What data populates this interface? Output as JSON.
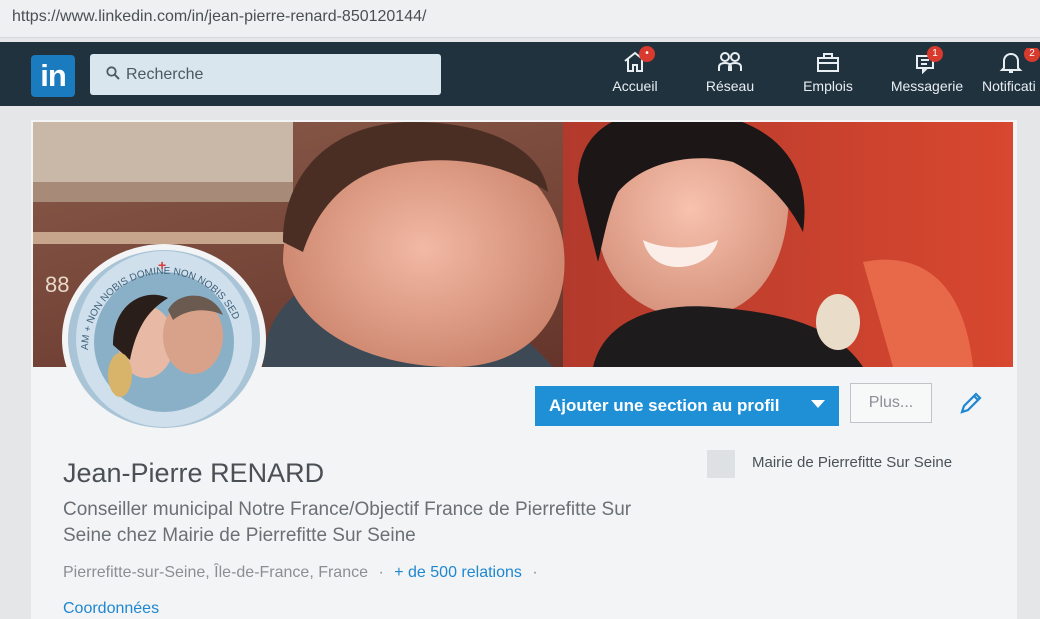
{
  "browser": {
    "url": "https://www.linkedin.com/in/jean-pierre-renard-850120144/"
  },
  "navbar": {
    "logo_text": "in",
    "search_placeholder": "Recherche",
    "items": [
      {
        "label": "Accueil",
        "icon": "home-icon",
        "badge": "•"
      },
      {
        "label": "Réseau",
        "icon": "network-icon"
      },
      {
        "label": "Emplois",
        "icon": "briefcase-icon"
      },
      {
        "label": "Messagerie",
        "icon": "messaging-icon",
        "badge": "1"
      },
      {
        "label": "Notificati",
        "icon": "bell-icon",
        "badge": "2"
      }
    ]
  },
  "profile": {
    "avatar_ring_text": "AM + NON NOBIS DOMINE NON NOBIS SED",
    "add_section_label": "Ajouter une section au profil",
    "more_label": "Plus...",
    "name": "Jean-Pierre RENARD",
    "headline": "Conseiller municipal Notre France/Objectif France de Pierrefitte Sur Seine chez Mairie de Pierrefitte Sur Seine",
    "location": "Pierrefitte-sur-Seine, Île-de-France, France",
    "separator": "·",
    "relations": "+ de 500 relations",
    "contact_label": "Coordonnées",
    "company": "Mairie de Pierrefitte Sur Seine"
  },
  "colors": {
    "linkedin_blue": "#1b7bbf",
    "navbar": "#21323f",
    "primary_button": "#1f8fd6",
    "link": "#1e87d1",
    "badge": "#d93a2e"
  }
}
